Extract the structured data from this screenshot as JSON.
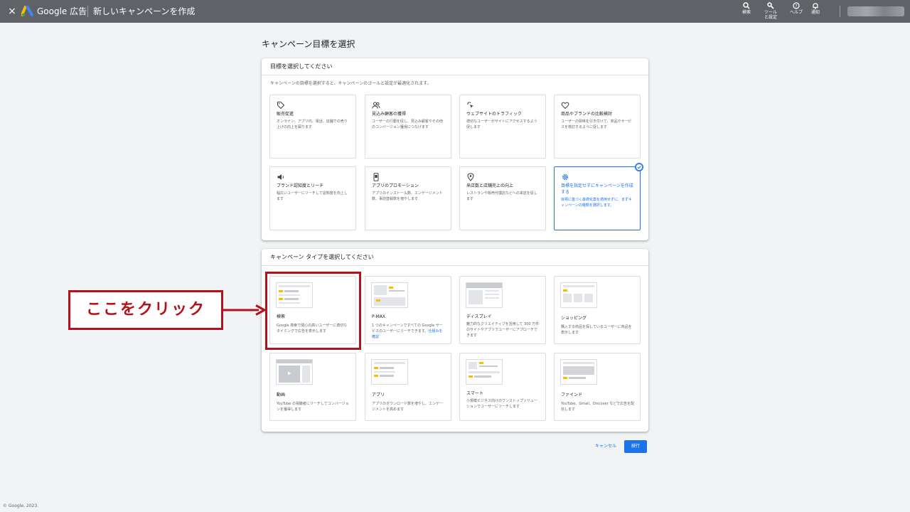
{
  "topbar": {
    "close_icon": "×",
    "brand": "Google 広告",
    "title": "新しいキャンペーンを作成",
    "tools": [
      {
        "icon": "search-icon",
        "label": "検索"
      },
      {
        "icon": "wrench-icon",
        "label": "ツールと設定"
      },
      {
        "icon": "help-icon",
        "label": "ヘルプ"
      },
      {
        "icon": "bell-icon",
        "label": "通知"
      }
    ]
  },
  "page_title": "キャンペーン目標を選択",
  "goal_panel": {
    "heading": "目標を選択してください",
    "description": "キャンペーンの目標を選択すると、キャンペーンのゴールと設定が最適化されます。",
    "goals": [
      {
        "icon": "tag-icon",
        "title": "販売促進",
        "desc": "オンライン、アプリ内、電話、店舗での売り上げの向上を図ります",
        "selected": false
      },
      {
        "icon": "people-icon",
        "title": "見込み顧客の獲得",
        "desc": "ユーザーの行動を促し、見込み顧客やその他のコンバージョン獲得につなげます",
        "selected": false
      },
      {
        "icon": "cursor-click-icon",
        "title": "ウェブサイトのトラフィック",
        "desc": "適切なユーザーがサイトにアクセスするよう促します",
        "selected": false
      },
      {
        "icon": "heart-icon",
        "title": "商品やブランドの比較検討",
        "desc": "ユーザーの興味を引き付けて、商品やサービスを検討するように促します",
        "selected": false
      },
      {
        "icon": "speaker-icon",
        "title": "ブランド認知度とリーチ",
        "desc": "幅広いユーザーにリーチして認知度を向上します",
        "selected": false
      },
      {
        "icon": "phone-icon",
        "title": "アプリのプロモーション",
        "desc": "アプリのインストール数、エンゲージメント数、事前登録数を増やします",
        "selected": false
      },
      {
        "icon": "location-pin-icon",
        "title": "来店数と店舗売上の向上",
        "desc": "レストランや販売代理店などへの来店を促します",
        "selected": false
      },
      {
        "icon": "gear-icon",
        "title": "目標を指定せずにキャンペーンを作成する",
        "desc": "目標に基づく最適化案を適用せずに、まずキャンペーンの種類を選択します。",
        "selected": true
      }
    ]
  },
  "type_panel": {
    "heading": "キャンペーン タイプを選択してください",
    "types": [
      {
        "name": "検索",
        "desc": "Google 検索で関心の高いユーザーに適切なタイミングで広告を表示します",
        "link": ""
      },
      {
        "name": "P-MAX",
        "desc": "1 つのキャンペーンですべての Google サービスのユーザーにリーチできます。",
        "link": "仕組みを確認"
      },
      {
        "name": "ディスプレイ",
        "desc": "魅力的なクリエイティブを活用して 300 万件のサイトやアプリでユーザーにアプローチできます",
        "link": ""
      },
      {
        "name": "ショッピング",
        "desc": "購入する商品を探しているユーザーに商品を表示します",
        "link": ""
      },
      {
        "name": "動画",
        "desc": "YouTube の視聴者にリーチしてコンバージョンを獲得します",
        "link": ""
      },
      {
        "name": "アプリ",
        "desc": "アプリのダウンロード数を増やし、エンゲージメントを高めます",
        "link": ""
      },
      {
        "name": "スマート",
        "desc": "小規模ビジネス向けのワンストップソリューションでユーザーにリーチします",
        "link": ""
      },
      {
        "name": "ファインド",
        "desc": "YouTube、Gmail、Discover などで広告を配信します",
        "link": ""
      }
    ]
  },
  "annotation": {
    "text": "ここをクリック",
    "color": "#b3121b"
  },
  "actions": {
    "cancel": "キャンセル",
    "next": "続行"
  },
  "footer": {
    "copyright": "© Google, 2023."
  },
  "colors": {
    "accent": "#1a73e8",
    "topbar": "#5f6368",
    "background": "#f1f3f4"
  }
}
